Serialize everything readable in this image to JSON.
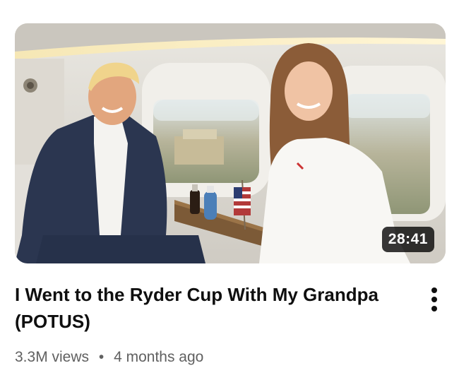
{
  "video": {
    "duration": "28:41",
    "title_line1": "I Went to the Ryder Cup With My Grandpa",
    "title_line2": "(POTUS)",
    "views": "3.3M views",
    "separator": "•",
    "age": "4 months ago"
  },
  "icons": {
    "more": "more-vert-icon"
  },
  "colors": {
    "title": "#0f0f0f",
    "meta": "#606060",
    "duration_bg": "#000000",
    "duration_text": "#ffffff"
  }
}
